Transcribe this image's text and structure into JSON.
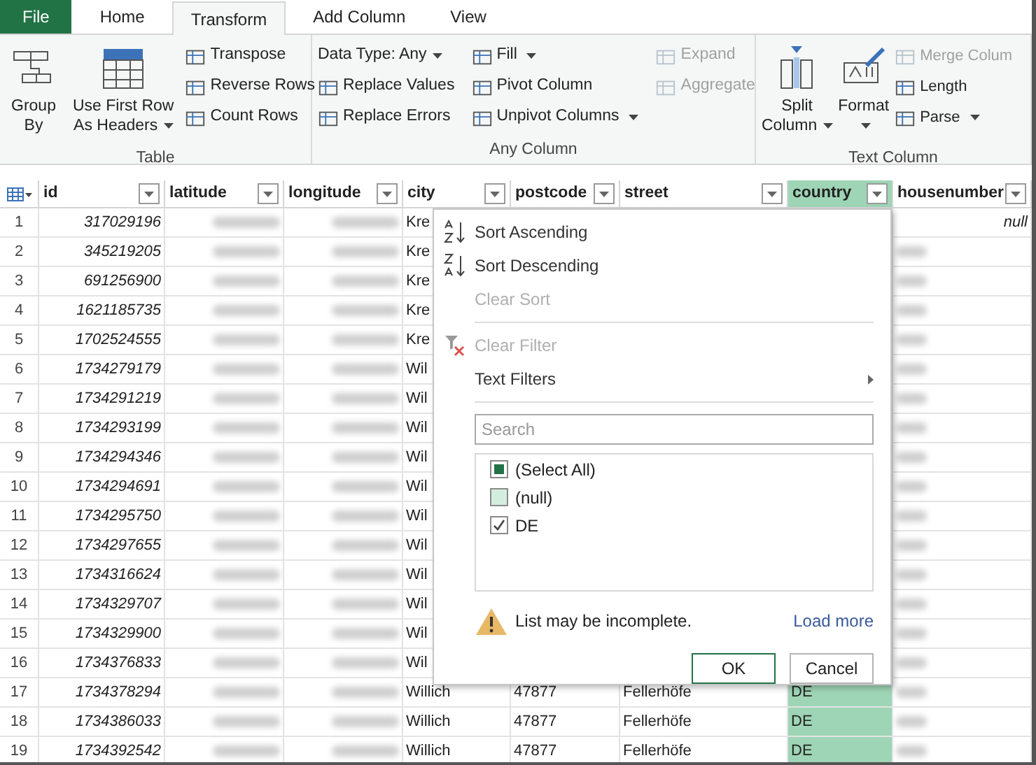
{
  "ribbon_tabs": [
    {
      "label": "File",
      "kind": "file",
      "selected": false
    },
    {
      "label": "Home",
      "kind": "tab",
      "selected": false
    },
    {
      "label": "Transform",
      "kind": "tab",
      "selected": true
    },
    {
      "label": "Add Column",
      "kind": "tab",
      "selected": false
    },
    {
      "label": "View",
      "kind": "tab",
      "selected": false
    }
  ],
  "ribbon_groups": [
    {
      "label": "Table",
      "columns": [
        [
          {
            "kind": "large",
            "lines": [
              "Group",
              "By"
            ],
            "dropdown": false,
            "disabled": false
          }
        ],
        [
          {
            "kind": "large",
            "lines": [
              "Use First Row",
              "As Headers"
            ],
            "dropdown": true,
            "disabled": false
          }
        ],
        [
          {
            "kind": "small",
            "label": "Transpose",
            "dropdown": false,
            "disabled": false
          },
          {
            "kind": "small",
            "label": "Reverse Rows",
            "dropdown": false,
            "disabled": false
          },
          {
            "kind": "small",
            "label": "Count Rows",
            "dropdown": false,
            "disabled": false
          }
        ]
      ]
    },
    {
      "label": "Any Column",
      "columns": [
        [
          {
            "kind": "text",
            "label": "Data Type: Any",
            "dropdown": true,
            "disabled": false
          },
          {
            "kind": "small",
            "label": "Replace Values",
            "dropdown": false,
            "disabled": false
          },
          {
            "kind": "small",
            "label": "Replace Errors",
            "dropdown": false,
            "disabled": false
          }
        ],
        [
          {
            "kind": "small",
            "label": "Fill",
            "dropdown": true,
            "disabled": false
          },
          {
            "kind": "small",
            "label": "Pivot Column",
            "dropdown": false,
            "disabled": false
          },
          {
            "kind": "small",
            "label": "Unpivot Columns",
            "dropdown": true,
            "disabled": false
          }
        ],
        [
          {
            "kind": "small",
            "label": "Expand",
            "dropdown": false,
            "disabled": true
          },
          {
            "kind": "small",
            "label": "Aggregate",
            "dropdown": false,
            "disabled": true
          }
        ]
      ]
    },
    {
      "label": "Text Column",
      "columns": [
        [
          {
            "kind": "large",
            "lines": [
              "Split",
              "Column"
            ],
            "dropdown": true,
            "disabled": false
          }
        ],
        [
          {
            "kind": "large",
            "lines": [
              "Format"
            ],
            "dropdown": true,
            "disabled": false
          }
        ],
        [
          {
            "kind": "small",
            "label": "Merge Colum",
            "dropdown": false,
            "disabled": true
          },
          {
            "kind": "small",
            "label": "Length",
            "dropdown": false,
            "disabled": false
          },
          {
            "kind": "small",
            "label": "Parse",
            "dropdown": true,
            "disabled": false
          }
        ]
      ]
    }
  ],
  "table": {
    "columns": [
      {
        "label": "id",
        "selected": false,
        "blurred": false
      },
      {
        "label": "latitude",
        "selected": false,
        "blurred": true
      },
      {
        "label": "longitude",
        "selected": false,
        "blurred": true
      },
      {
        "label": "city",
        "selected": false,
        "blurred": false
      },
      {
        "label": "postcode",
        "selected": false,
        "blurred": false
      },
      {
        "label": "street",
        "selected": false,
        "blurred": false
      },
      {
        "label": "country",
        "selected": true,
        "blurred": false
      },
      {
        "label": "housenumber",
        "selected": false,
        "blurred": false
      }
    ],
    "rows": [
      {
        "number": "1",
        "id": "317029196",
        "city": "Kre",
        "housenumber": {
          "kind": "null",
          "text": "null"
        }
      },
      {
        "number": "2",
        "id": "345219205",
        "city": "Kre",
        "housenumber": {
          "kind": "blurred"
        }
      },
      {
        "number": "3",
        "id": "691256900",
        "city": "Kre",
        "housenumber": {
          "kind": "blurred"
        }
      },
      {
        "number": "4",
        "id": "1621185735",
        "city": "Kre",
        "housenumber": {
          "kind": "blurred"
        }
      },
      {
        "number": "5",
        "id": "1702524555",
        "city": "Kre",
        "housenumber": {
          "kind": "blurred"
        }
      },
      {
        "number": "6",
        "id": "1734279179",
        "city": "Wil",
        "housenumber": {
          "kind": "blurred"
        }
      },
      {
        "number": "7",
        "id": "1734291219",
        "city": "Wil",
        "housenumber": {
          "kind": "blurred"
        }
      },
      {
        "number": "8",
        "id": "1734293199",
        "city": "Wil",
        "housenumber": {
          "kind": "blurred"
        }
      },
      {
        "number": "9",
        "id": "1734294346",
        "city": "Wil",
        "housenumber": {
          "kind": "blurred"
        }
      },
      {
        "number": "10",
        "id": "1734294691",
        "city": "Wil",
        "housenumber": {
          "kind": "blurred"
        }
      },
      {
        "number": "11",
        "id": "1734295750",
        "city": "Wil",
        "housenumber": {
          "kind": "blurred"
        }
      },
      {
        "number": "12",
        "id": "1734297655",
        "city": "Wil",
        "housenumber": {
          "kind": "blurred"
        }
      },
      {
        "number": "13",
        "id": "1734316624",
        "city": "Wil",
        "housenumber": {
          "kind": "blurred"
        }
      },
      {
        "number": "14",
        "id": "1734329707",
        "city": "Wil",
        "housenumber": {
          "kind": "blurred"
        }
      },
      {
        "number": "15",
        "id": "1734329900",
        "city": "Wil",
        "housenumber": {
          "kind": "blurred"
        }
      },
      {
        "number": "16",
        "id": "1734376833",
        "city": "Wil",
        "housenumber": {
          "kind": "blurred"
        }
      },
      {
        "number": "17",
        "id": "1734378294",
        "city": "Willich",
        "postcode": "47877",
        "street": "Fellerhöfe",
        "country": "DE",
        "housenumber": {
          "kind": "blurred"
        }
      },
      {
        "number": "18",
        "id": "1734386033",
        "city": "Willich",
        "postcode": "47877",
        "street": "Fellerhöfe",
        "country": "DE",
        "housenumber": {
          "kind": "blurred"
        }
      },
      {
        "number": "19",
        "id": "1734392542",
        "city": "Willich",
        "postcode": "47877",
        "street": "Fellerhöfe",
        "country": "DE",
        "housenumber": {
          "kind": "blurred"
        }
      }
    ]
  },
  "filter_menu": {
    "items": [
      {
        "kind": "item",
        "label": "Sort Ascending",
        "disabled": false,
        "submenu": false
      },
      {
        "kind": "item",
        "label": "Sort Descending",
        "disabled": false,
        "submenu": false
      },
      {
        "kind": "item",
        "label": "Clear Sort",
        "disabled": true,
        "submenu": false
      },
      {
        "kind": "separator"
      },
      {
        "kind": "item",
        "label": "Clear Filter",
        "disabled": true,
        "submenu": false
      },
      {
        "kind": "item",
        "label": "Text Filters",
        "disabled": false,
        "submenu": true
      },
      {
        "kind": "separator"
      }
    ],
    "search": {
      "placeholder": "Search"
    },
    "values": [
      {
        "label": "(Select All)",
        "checked": false,
        "mixed": true,
        "hovered": false
      },
      {
        "label": "(null)",
        "checked": false,
        "mixed": false,
        "hovered": true
      },
      {
        "label": "DE",
        "checked": true,
        "mixed": false,
        "hovered": false
      }
    ],
    "warning": "List may be incomplete.",
    "load_more": "Load more",
    "buttons": [
      {
        "label": "OK",
        "default": true
      },
      {
        "label": "Cancel",
        "default": false
      }
    ]
  }
}
